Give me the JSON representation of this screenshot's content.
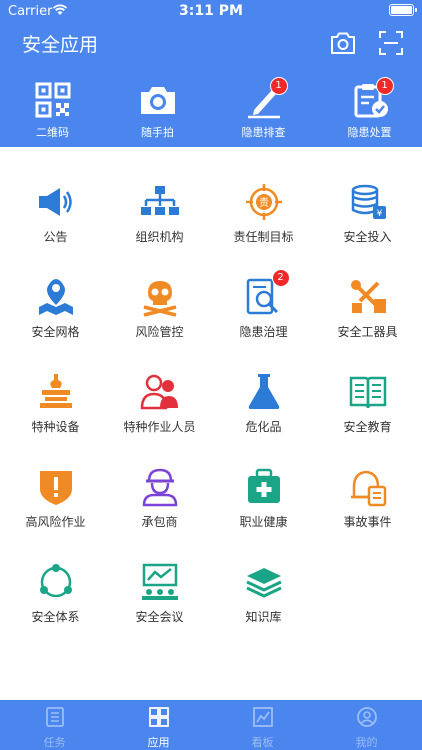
{
  "status": {
    "carrier": "Carrier",
    "time": "3:11 PM"
  },
  "header": {
    "title": "安全应用",
    "quick": [
      {
        "label": "二维码",
        "icon": "qr-code-icon"
      },
      {
        "label": "随手拍",
        "icon": "camera-icon"
      },
      {
        "label": "隐患排查",
        "icon": "pen-icon",
        "badge": "1"
      },
      {
        "label": "隐患处置",
        "icon": "clipboard-check-icon",
        "badge": "1"
      }
    ]
  },
  "grid": [
    {
      "label": "公告",
      "icon": "speaker-icon"
    },
    {
      "label": "组织机构",
      "icon": "org-chart-icon"
    },
    {
      "label": "责任制目标",
      "icon": "target-icon"
    },
    {
      "label": "安全投入",
      "icon": "coins-icon"
    },
    {
      "label": "安全网格",
      "icon": "map-pin-icon"
    },
    {
      "label": "风险管控",
      "icon": "skull-icon"
    },
    {
      "label": "隐患治理",
      "icon": "search-doc-icon",
      "badge": "2"
    },
    {
      "label": "安全工器具",
      "icon": "tools-icon"
    },
    {
      "label": "特种设备",
      "icon": "crane-icon"
    },
    {
      "label": "特种作业人员",
      "icon": "workers-icon"
    },
    {
      "label": "危化品",
      "icon": "flask-icon"
    },
    {
      "label": "安全教育",
      "icon": "book-icon"
    },
    {
      "label": "高风险作业",
      "icon": "warning-shield-icon"
    },
    {
      "label": "承包商",
      "icon": "contractor-icon"
    },
    {
      "label": "职业健康",
      "icon": "medkit-icon"
    },
    {
      "label": "事故事件",
      "icon": "alarm-bell-icon"
    },
    {
      "label": "安全体系",
      "icon": "cycle-icon"
    },
    {
      "label": "安全会议",
      "icon": "meeting-icon"
    },
    {
      "label": "知识库",
      "icon": "stack-books-icon"
    }
  ],
  "tabs": [
    {
      "label": "任务",
      "icon": "task-list-icon"
    },
    {
      "label": "应用",
      "icon": "apps-grid-icon",
      "active": true
    },
    {
      "label": "看板",
      "icon": "dashboard-chart-icon"
    },
    {
      "label": "我的",
      "icon": "user-icon"
    }
  ],
  "colors": {
    "primary": "#4A86EE",
    "badge": "#F02A2A"
  }
}
